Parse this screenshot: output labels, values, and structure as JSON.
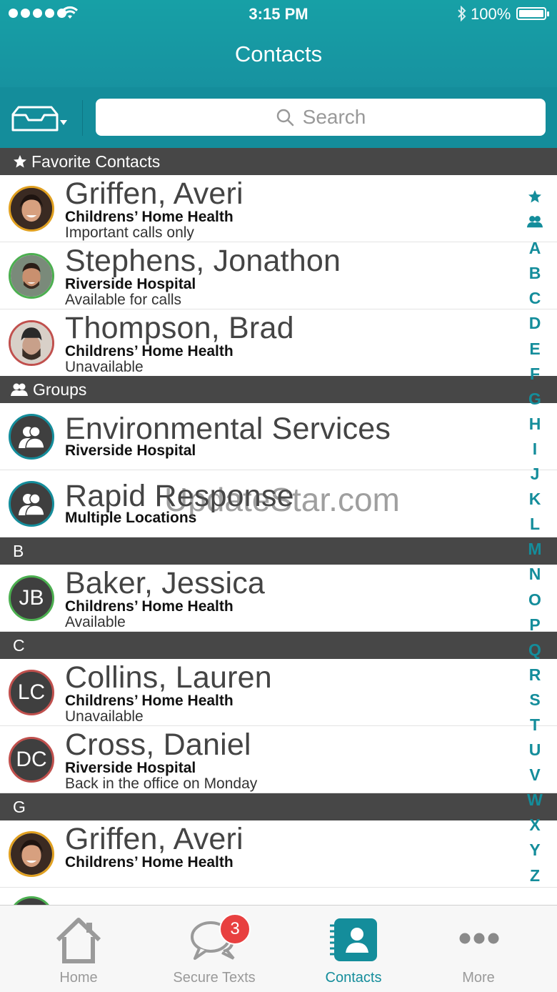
{
  "status_bar": {
    "time": "3:15 PM",
    "battery": "100%"
  },
  "nav": {
    "title": "Contacts"
  },
  "search": {
    "placeholder": "Search"
  },
  "sections": {
    "favorites": "Favorite Contacts",
    "groups": "Groups",
    "b": "B",
    "c": "C",
    "g": "G"
  },
  "favorites": [
    {
      "name": "Griffen, Averi",
      "org": "Childrens’ Home Health",
      "note": "Important calls only"
    },
    {
      "name": "Stephens, Jonathon",
      "org": "Riverside Hospital",
      "note": "Available for calls"
    },
    {
      "name": "Thompson, Brad",
      "org": "Childrens’ Home Health",
      "note": "Unavailable"
    }
  ],
  "groups": [
    {
      "name": "Environmental Services",
      "org": "Riverside Hospital"
    },
    {
      "name": "Rapid Response",
      "org": "Multiple Locations"
    }
  ],
  "b_contacts": [
    {
      "initials": "JB",
      "name": "Baker, Jessica",
      "org": "Childrens’ Home Health",
      "note": "Available"
    }
  ],
  "c_contacts": [
    {
      "initials": "LC",
      "name": "Collins, Lauren",
      "org": "Childrens’ Home Health",
      "note": "Unavailable"
    },
    {
      "initials": "DC",
      "name": "Cross, Daniel",
      "org": "Riverside Hospital",
      "note": "Back in the office on Monday"
    }
  ],
  "g_contacts": [
    {
      "name": "Griffen, Averi",
      "org": "Childrens’ Home Health"
    }
  ],
  "index_letters": [
    "A",
    "B",
    "C",
    "D",
    "E",
    "F",
    "G",
    "H",
    "I",
    "J",
    "K",
    "L",
    "M",
    "N",
    "O",
    "P",
    "Q",
    "R",
    "S",
    "T",
    "U",
    "V",
    "W",
    "X",
    "Y",
    "Z"
  ],
  "watermark": "UpdateStar.com",
  "tabs": [
    {
      "label": "Home",
      "icon": "home-icon"
    },
    {
      "label": "Secure Texts",
      "icon": "chat-bubbles-icon",
      "badge": "3"
    },
    {
      "label": "Contacts",
      "icon": "contacts-book-icon",
      "active": true
    },
    {
      "label": "More",
      "icon": "more-dots-icon"
    }
  ],
  "colors": {
    "accent": "#148d9b",
    "section_bg": "#474747",
    "badge": "#e84040",
    "available": "#4caf50",
    "unavailable": "#c0504d",
    "important": "#e0a020",
    "group_ring": "#148d9b"
  }
}
